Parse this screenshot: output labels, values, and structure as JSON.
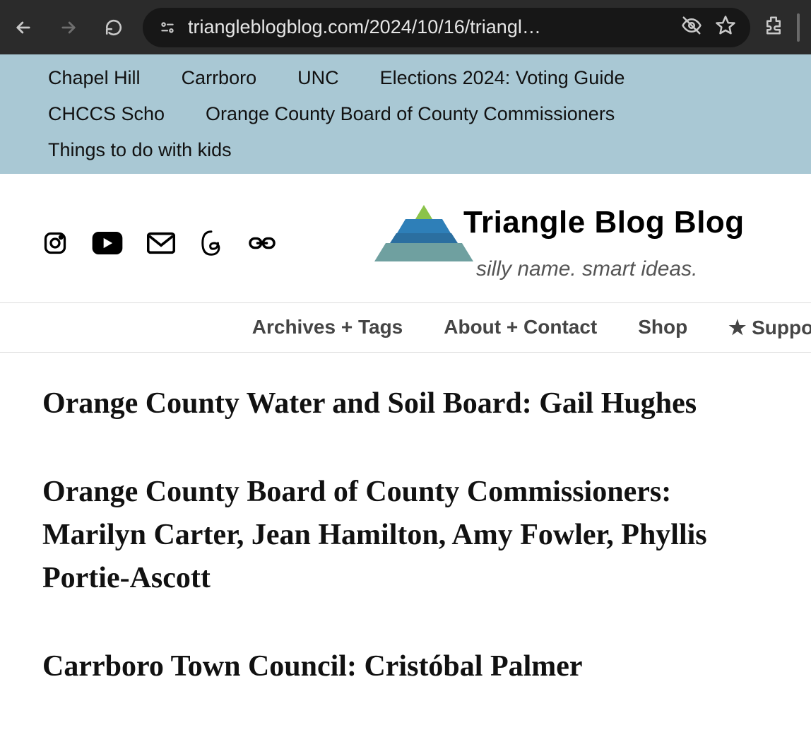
{
  "browser": {
    "url_display": "triangleblogblog.com/2024/10/16/triangl…"
  },
  "top_nav": {
    "items": [
      "Chapel Hill",
      "Carrboro",
      "UNC",
      "Elections 2024: Voting Guide",
      "CHCCS Scho",
      "Orange County Board of County Commissioners",
      "Things to do with kids"
    ]
  },
  "site": {
    "title": "Triangle Blog Blog",
    "tagline": "silly name. smart ideas."
  },
  "secondary_nav": {
    "items": [
      "Archives + Tags",
      "About + Contact",
      "Shop",
      "★ Suppo"
    ]
  },
  "article": {
    "headings": [
      "Orange County Water and Soil Board: Gail Hughes",
      "Orange County Board of County Commissioners: Marilyn Carter, Jean Hamilton, Amy Fowler, Phyllis Portie-Ascott",
      "Carrboro Town Council: Cristóbal Palmer"
    ]
  }
}
